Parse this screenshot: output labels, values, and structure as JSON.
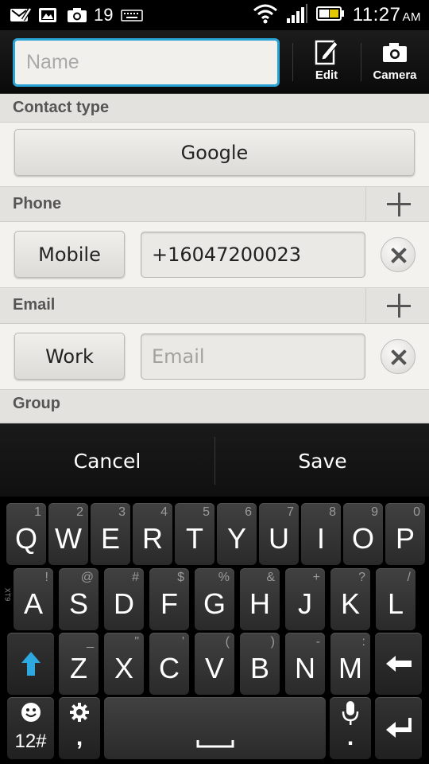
{
  "status_bar": {
    "notification_count": "19",
    "time": "11:27",
    "ampm": "AM",
    "icons": [
      "mail-edit-icon",
      "image-icon",
      "camera-icon",
      "keyboard-icon",
      "wifi-icon",
      "signal-icon",
      "battery-icon"
    ]
  },
  "action_bar": {
    "name_placeholder": "Name",
    "name_value": "",
    "edit_label": "Edit",
    "camera_label": "Camera",
    "accent_color": "#29a3d6"
  },
  "sections": {
    "contact_type": {
      "label": "Contact type",
      "value": "Google"
    },
    "phone": {
      "label": "Phone",
      "type": "Mobile",
      "value": "+16047200023"
    },
    "email": {
      "label": "Email",
      "type": "Work",
      "placeholder": "Email",
      "value": ""
    },
    "group": {
      "label": "Group"
    }
  },
  "bottom_bar": {
    "cancel": "Cancel",
    "save": "Save"
  },
  "keyboard": {
    "side_label": "XT9",
    "row1": [
      {
        "k": "Q",
        "a": "1"
      },
      {
        "k": "W",
        "a": "2"
      },
      {
        "k": "E",
        "a": "3"
      },
      {
        "k": "R",
        "a": "4"
      },
      {
        "k": "T",
        "a": "5"
      },
      {
        "k": "Y",
        "a": "6"
      },
      {
        "k": "U",
        "a": "7"
      },
      {
        "k": "I",
        "a": "8"
      },
      {
        "k": "O",
        "a": "9"
      },
      {
        "k": "P",
        "a": "0"
      }
    ],
    "row2": [
      {
        "k": "A",
        "a": "!"
      },
      {
        "k": "S",
        "a": "@"
      },
      {
        "k": "D",
        "a": "#"
      },
      {
        "k": "F",
        "a": "$"
      },
      {
        "k": "G",
        "a": "%"
      },
      {
        "k": "H",
        "a": "&"
      },
      {
        "k": "J",
        "a": "+"
      },
      {
        "k": "K",
        "a": "?"
      },
      {
        "k": "L",
        "a": "/"
      }
    ],
    "row3": [
      {
        "k": "Z",
        "a": "_"
      },
      {
        "k": "X",
        "a": "\""
      },
      {
        "k": "C",
        "a": "'"
      },
      {
        "k": "V",
        "a": "("
      },
      {
        "k": "B",
        "a": ")"
      },
      {
        "k": "N",
        "a": "-"
      },
      {
        "k": "M",
        "a": ":"
      }
    ],
    "numbers_label": "12#",
    "comma_label": ",",
    "period_label": "."
  }
}
